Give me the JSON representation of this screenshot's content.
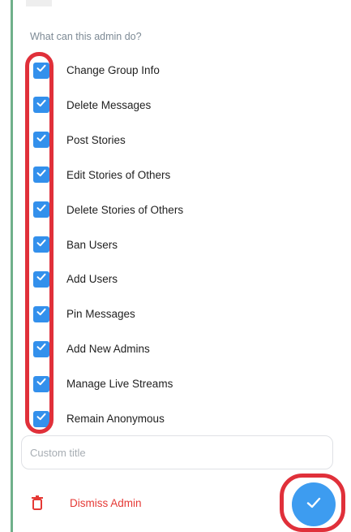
{
  "section_header": "What can this admin do?",
  "permissions": [
    {
      "label": "Change Group Info",
      "checked": true
    },
    {
      "label": "Delete Messages",
      "checked": true
    },
    {
      "label": "Post Stories",
      "checked": true
    },
    {
      "label": "Edit Stories of Others",
      "checked": true
    },
    {
      "label": "Delete Stories of Others",
      "checked": true
    },
    {
      "label": "Ban Users",
      "checked": true
    },
    {
      "label": "Add Users",
      "checked": true
    },
    {
      "label": "Pin Messages",
      "checked": true
    },
    {
      "label": "Add New Admins",
      "checked": true
    },
    {
      "label": "Manage Live Streams",
      "checked": true
    },
    {
      "label": "Remain Anonymous",
      "checked": true
    }
  ],
  "custom_title": {
    "placeholder": "Custom title",
    "value": ""
  },
  "dismiss": {
    "label": "Dismiss Admin",
    "icon": "trash-icon"
  },
  "confirm_button": {
    "icon": "checkmark-icon"
  },
  "colors": {
    "accent": "#3390ec",
    "danger": "#e53935",
    "highlight": "#e0303a"
  }
}
